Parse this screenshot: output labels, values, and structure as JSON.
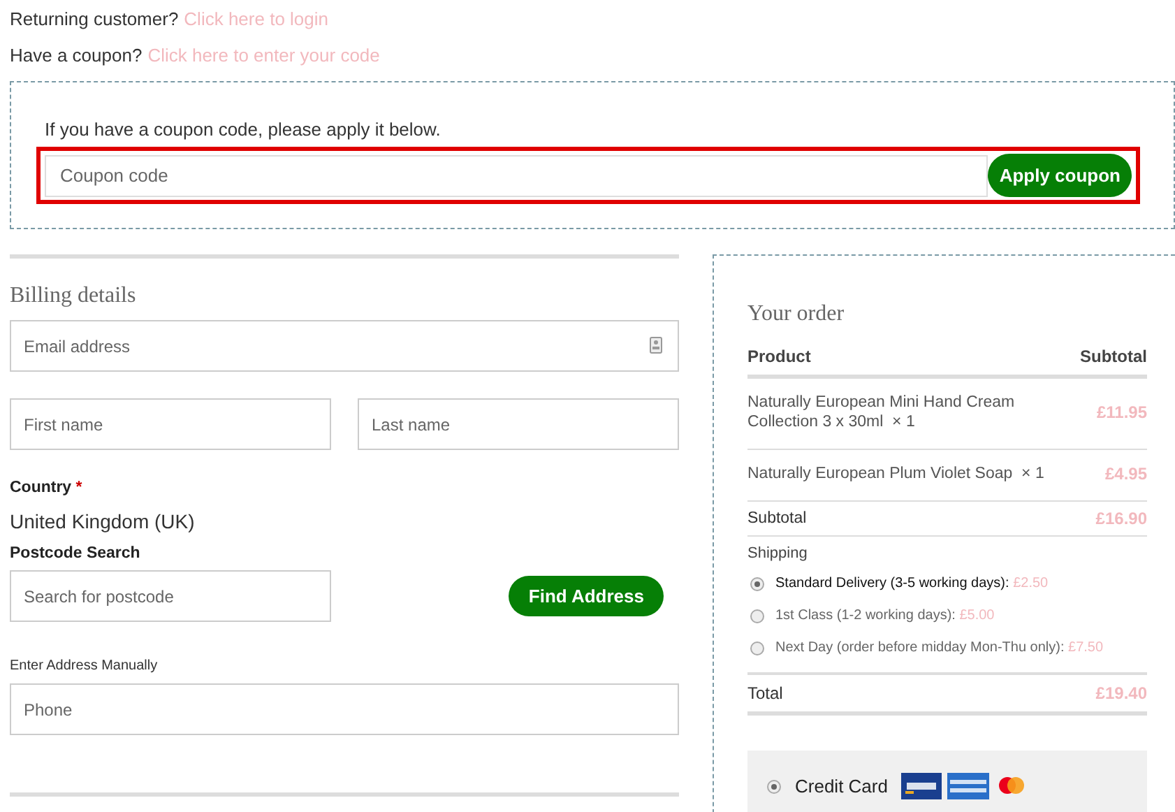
{
  "notices": [
    {
      "prompt": "Returning customer?",
      "link": "Click here to login"
    },
    {
      "prompt": "Have a coupon?",
      "link": "Click here to enter your code"
    }
  ],
  "coupon": {
    "intro": "If you have a coupon code, please apply it below.",
    "placeholder": "Coupon code",
    "button": "Apply coupon",
    "highlighted": true
  },
  "billing": {
    "title": "Billing details",
    "email_placeholder": "Email address",
    "first_name_placeholder": "First name",
    "last_name_placeholder": "Last name",
    "country_label": "Country",
    "required_mark": "*",
    "country": "United Kingdom (UK)",
    "postcode_label": "Postcode Search",
    "postcode_placeholder": "Search for postcode",
    "find_button": "Find Address",
    "manual_link": "Enter Address Manually",
    "phone_placeholder": "Phone"
  },
  "order": {
    "title": "Your order",
    "columns": [
      "Product",
      "Subtotal"
    ],
    "items": [
      {
        "name": "Naturally European Mini Hand Cream Collection 3 x 30ml",
        "qty": "× 1",
        "price": "£11.95"
      },
      {
        "name": "Naturally European Plum Violet Soap",
        "qty": "× 1",
        "price": "£4.95"
      }
    ],
    "subtotal_label": "Subtotal",
    "subtotal": "£16.90",
    "shipping_label": "Shipping",
    "shipping": [
      {
        "label": "Standard Delivery (3-5 working days):",
        "price": "£2.50",
        "selected": true
      },
      {
        "label": "1st Class (1-2 working days):",
        "price": "£5.00",
        "selected": false
      },
      {
        "label": "Next Day (order before midday Mon-Thu only):",
        "price": "£7.50",
        "selected": false
      }
    ],
    "total_label": "Total",
    "total": "£19.40",
    "payment": [
      {
        "label": "Credit Card",
        "selected": true
      }
    ]
  }
}
